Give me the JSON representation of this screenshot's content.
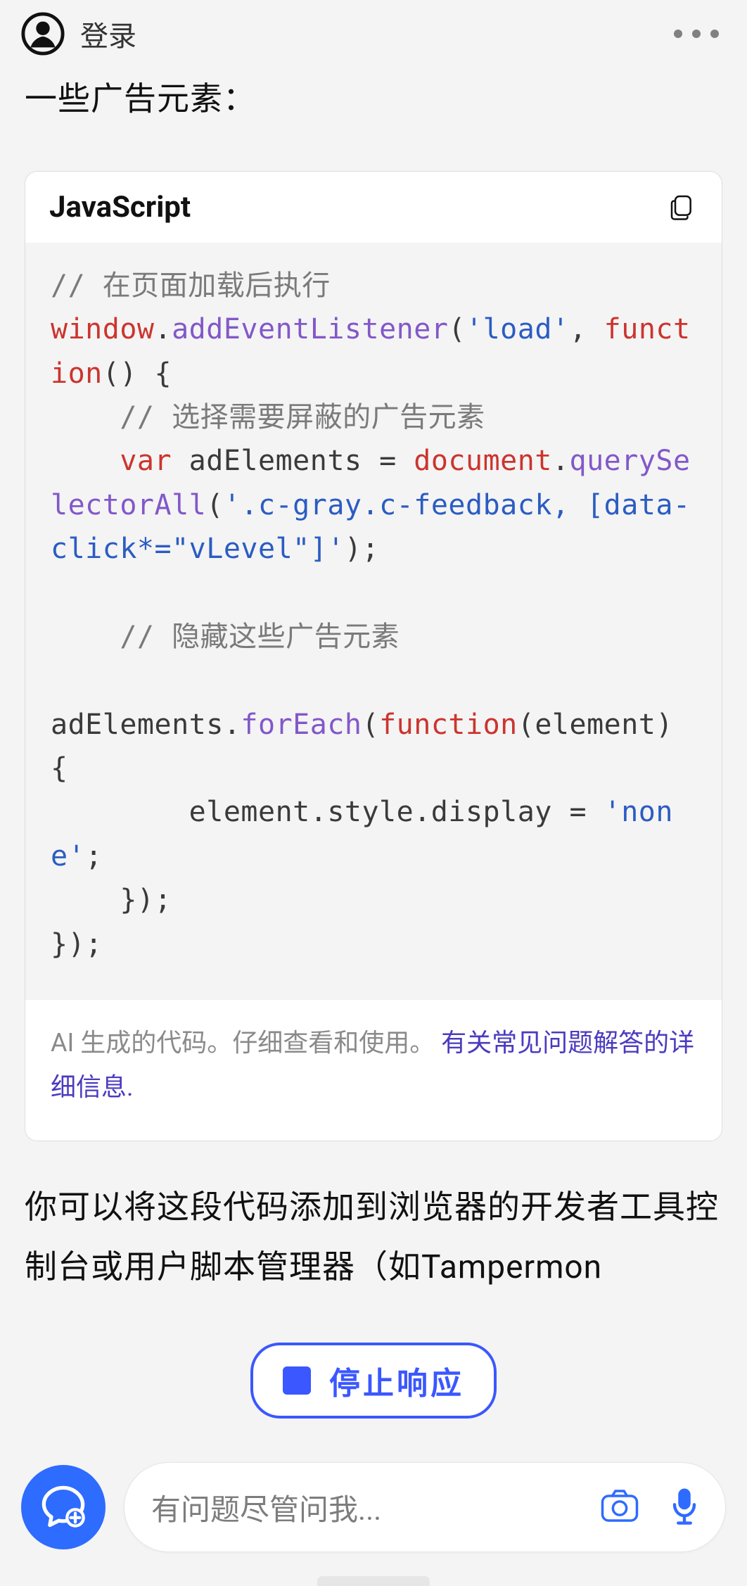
{
  "header": {
    "login": "登录"
  },
  "partial_text": "一些广告元素：",
  "code": {
    "lang": "JavaScript",
    "c1": "// 在页面加载后执行",
    "l2a": "window",
    "l2b": "addEventListener",
    "l2c": "'load'",
    "l3a": "function",
    "c4": "// 选择需要屏蔽的广告元素",
    "l5a": "var",
    "l5b": " adElements = ",
    "l6a": "document",
    "l6b": "querySelectorAll",
    "l6c": "'.c-gray.c-feedback, [data-click*=\"vLevel\"]'",
    "c8": "// 隐藏这些广告元素",
    "l9a": "adElements.",
    "l9b": "forEach",
    "l9c": "function",
    "l9d": "(element) {",
    "l10": "        element.style.display = ",
    "l10s": "'none'",
    "l11": "    });",
    "l12": "});",
    "footer_note": "AI 生成的代码。仔细查看和使用。 ",
    "footer_link": "有关常见问题解答的详细信息",
    "footer_dot": "."
  },
  "after_code_text": "你可以将这段代码添加到浏览器的开发者工具控制台或用户脚本管理器（如Tampermon",
  "stop_label": "停止响应",
  "input_placeholder": "有问题尽管问我..."
}
